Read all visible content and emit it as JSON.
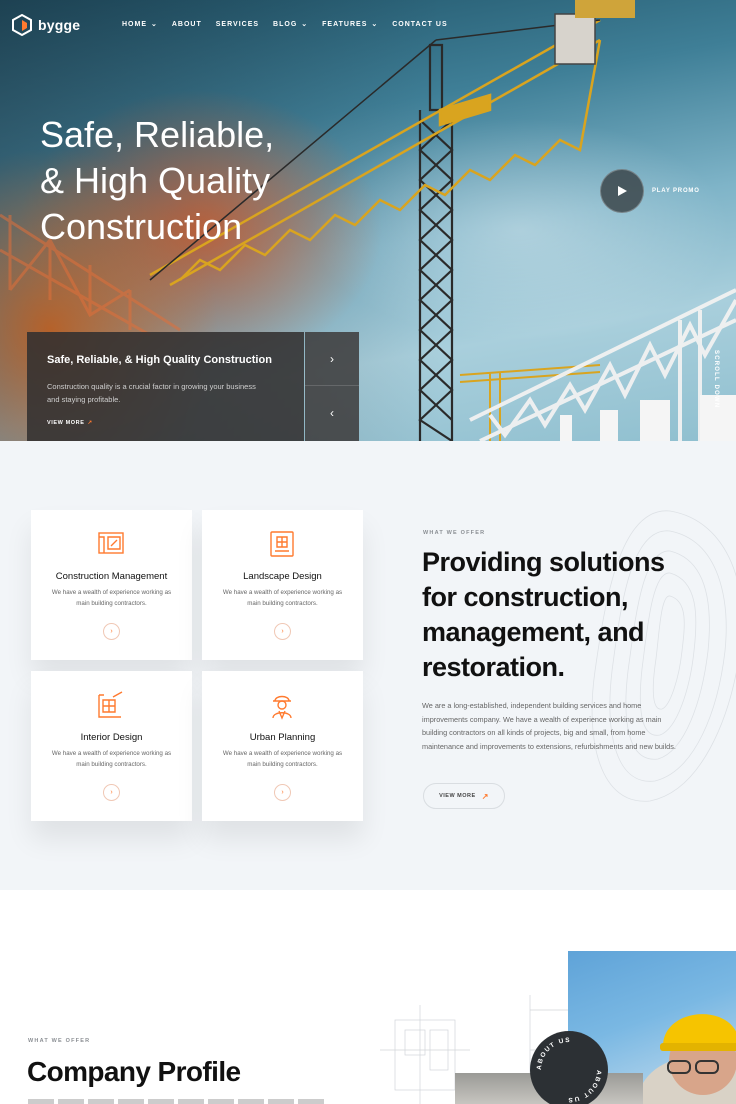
{
  "nav": {
    "brand": "bygge",
    "items": [
      {
        "label": "HOME",
        "dropdown": true
      },
      {
        "label": "ABOUT",
        "dropdown": false
      },
      {
        "label": "SERVICES",
        "dropdown": false
      },
      {
        "label": "BLOG",
        "dropdown": true
      },
      {
        "label": "FEATURES",
        "dropdown": true
      },
      {
        "label": "CONTACT US",
        "dropdown": false
      }
    ]
  },
  "hero": {
    "title_lines": [
      "Safe, Reliable,",
      "& High Quality",
      "Construction"
    ],
    "play_label": "PLAY PROMO",
    "scroll_label": "SCROLL DOWN",
    "card": {
      "title": "Safe, Reliable, & High Quality Construction",
      "text": "Construction quality is a crucial factor in growing your business and staying profitable.",
      "link": "VIEW MORE"
    }
  },
  "services": {
    "items": [
      {
        "title": "Construction Management",
        "text": "We have a wealth of experience working as main building contractors.",
        "icon": "blueprint-icon"
      },
      {
        "title": "Landscape Design",
        "text": "We have a wealth of experience working as main building contractors.",
        "icon": "landscape-plan-icon"
      },
      {
        "title": "Interior Design",
        "text": "We have a wealth of experience working as main building contractors.",
        "icon": "interior-plan-icon"
      },
      {
        "title": "Urban Planning",
        "text": "We have a wealth of experience working as main building contractors.",
        "icon": "worker-icon"
      }
    ],
    "tag": "WHAT WE OFFER",
    "title_lines": [
      "Providing solutions",
      "for construction,",
      "management, and",
      "restoration."
    ],
    "text": "We are a long-established, independent building services and home improvements company. We have a wealth of experience working as main building contractors on all kinds of projects, big and small, from home maintenance and improvements to extensions, refurbishments and new builds.",
    "button": "VIEW MORE"
  },
  "profile": {
    "tag": "WHAT WE OFFER",
    "title": "Company Profile",
    "badge": "ABOUT US"
  },
  "colors": {
    "accent": "#ff7a2f",
    "dark": "#2c3034",
    "bg_light": "#f2f5f8"
  }
}
